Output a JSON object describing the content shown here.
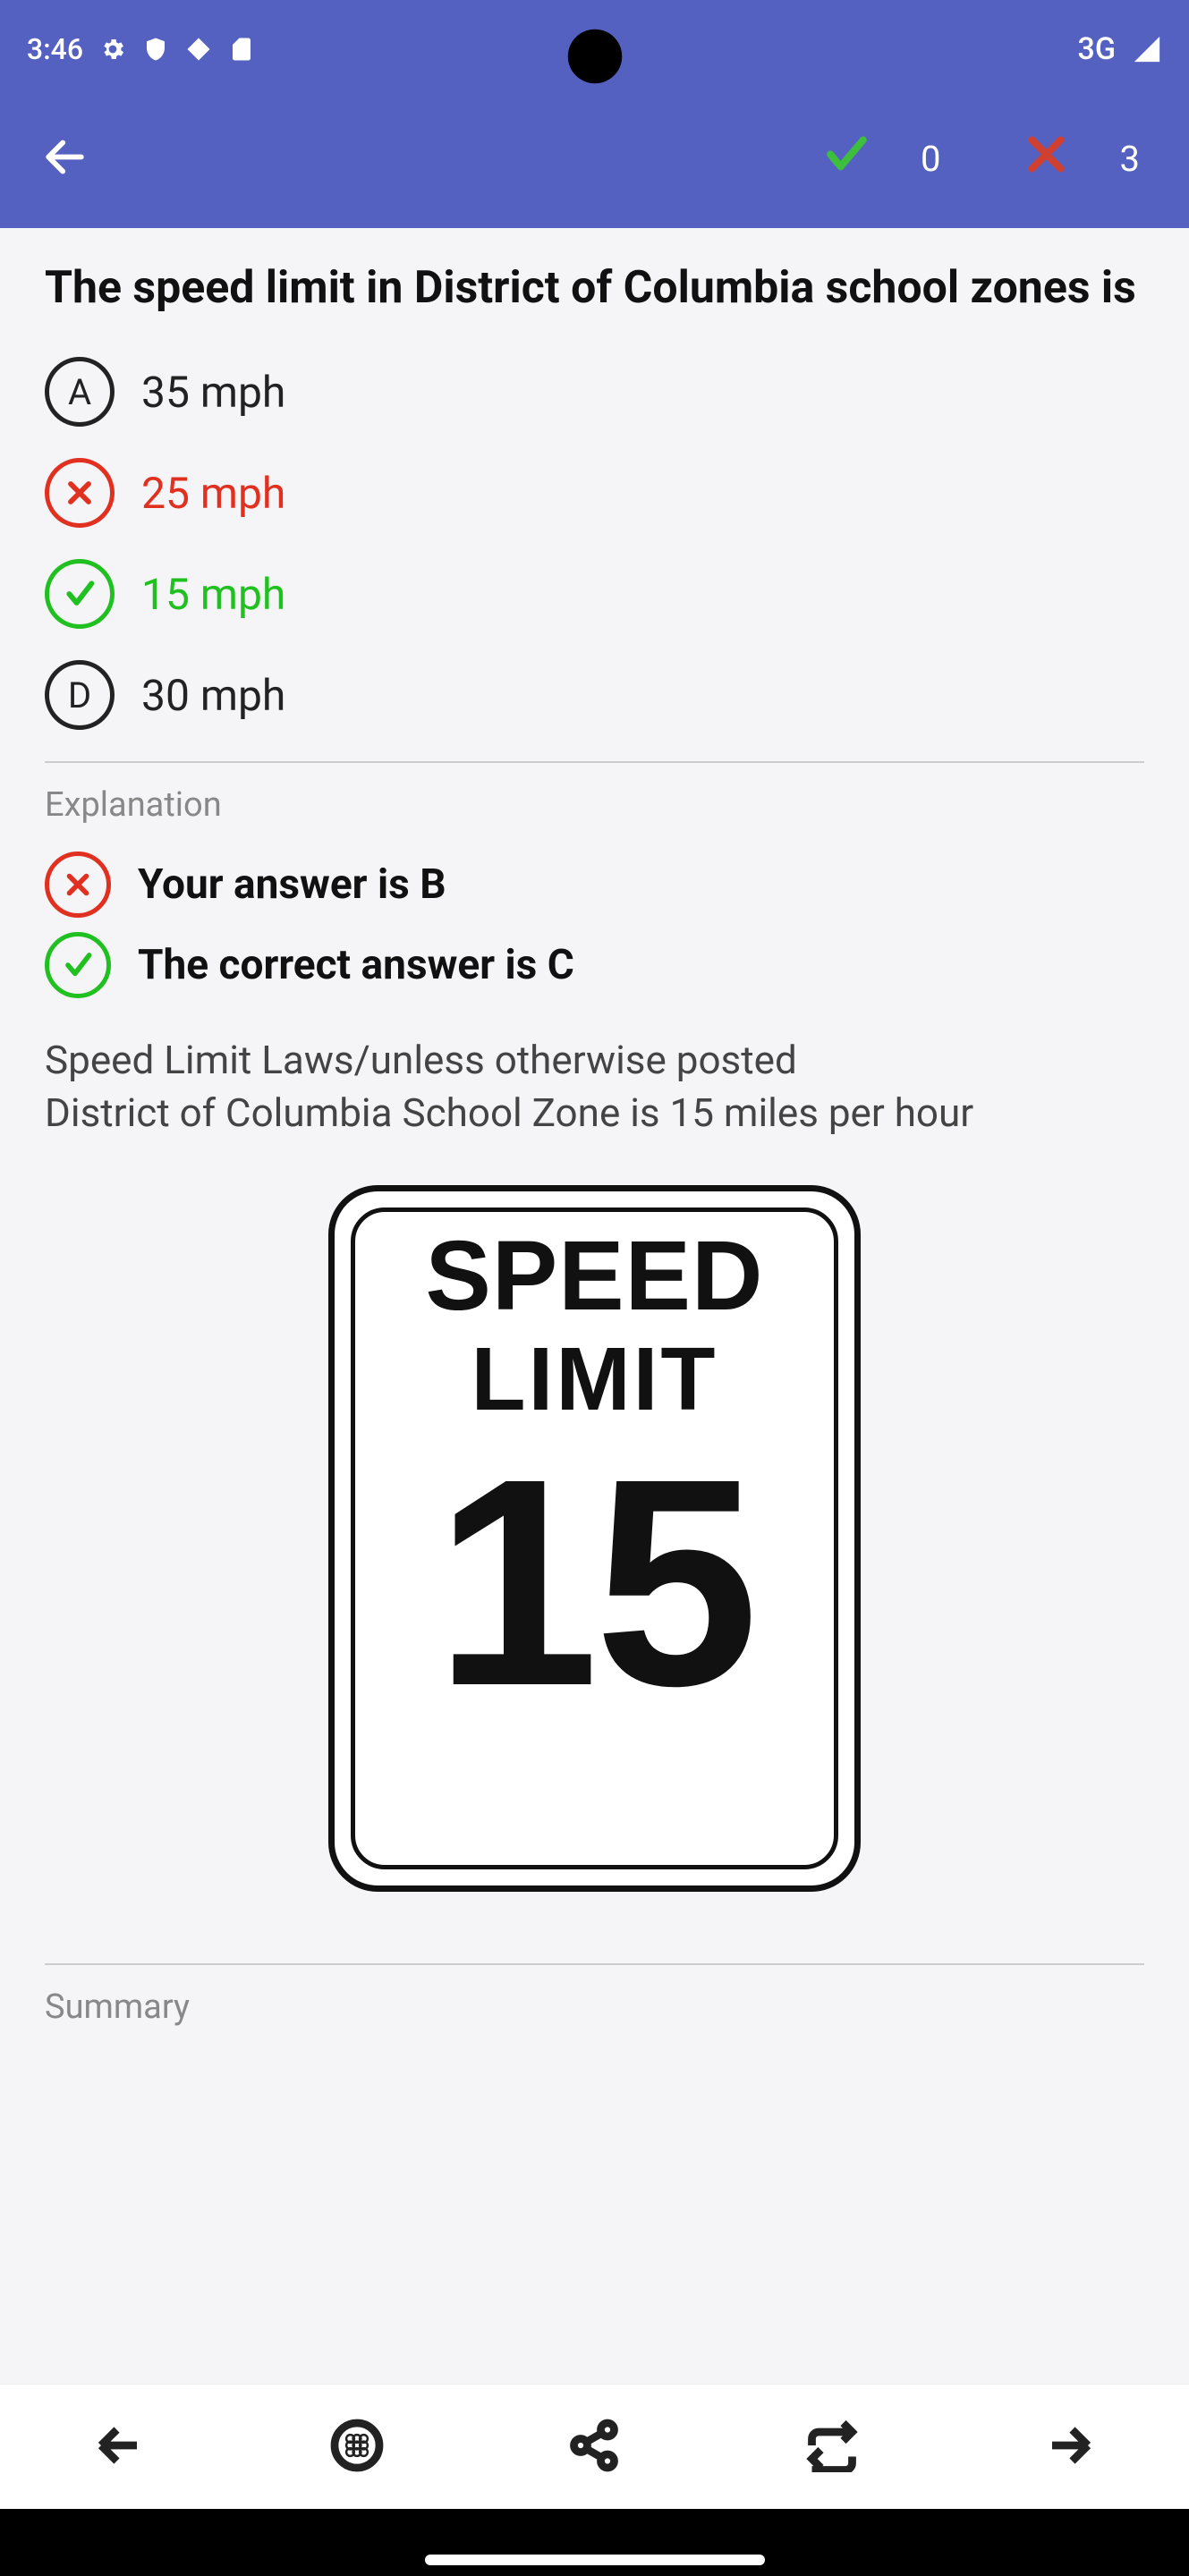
{
  "status": {
    "time": "3:46",
    "network": "3G"
  },
  "app_bar": {
    "correct_count": "0",
    "wrong_count": "3"
  },
  "question": "The speed limit in District of Columbia school zones is",
  "options": [
    {
      "letter": "A",
      "text": "35 mph",
      "state": "neutral"
    },
    {
      "letter": "B",
      "text": "25 mph",
      "state": "wrong"
    },
    {
      "letter": "C",
      "text": "15 mph",
      "state": "correct"
    },
    {
      "letter": "D",
      "text": "30 mph",
      "state": "neutral"
    }
  ],
  "labels": {
    "explanation": "Explanation",
    "summary": "Summary"
  },
  "result": {
    "your_answer": "Your answer is B",
    "correct_answer": "The correct answer is C"
  },
  "explanation_text": "Speed Limit Laws/unless otherwise posted\nDistrict of Columbia School Zone is 15 miles per hour",
  "sign": {
    "line1": "SPEED",
    "line2": "LIMIT",
    "number": "15"
  }
}
